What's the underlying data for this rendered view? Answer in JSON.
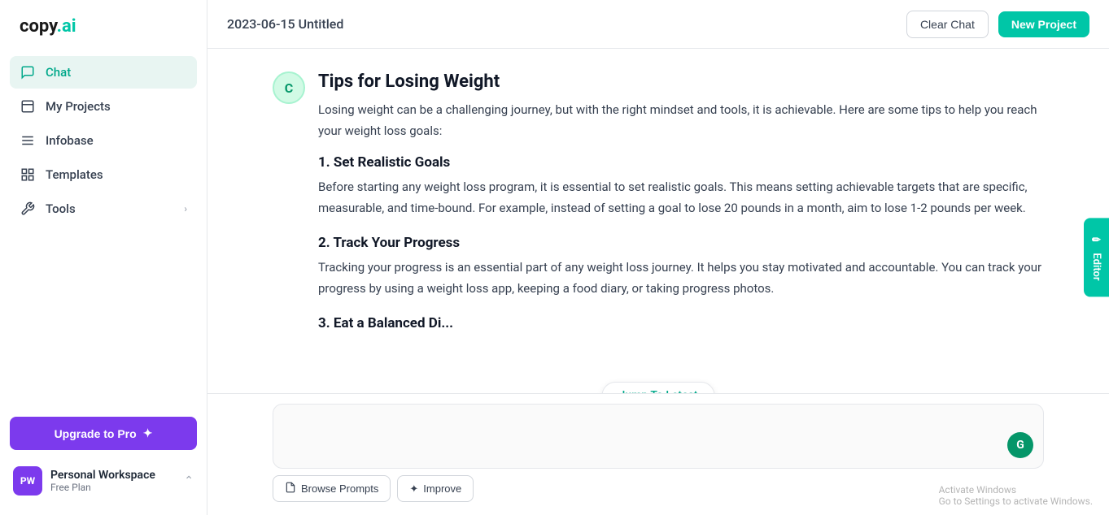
{
  "app": {
    "logo": "copy",
    "logo_dot": ".ai"
  },
  "header": {
    "title": "2023-06-15 Untitled",
    "clear_chat_label": "Clear Chat",
    "new_project_label": "New Project"
  },
  "sidebar": {
    "nav_items": [
      {
        "id": "chat",
        "label": "Chat",
        "icon": "💬",
        "active": true
      },
      {
        "id": "my-projects",
        "label": "My Projects",
        "icon": "📄",
        "active": false
      },
      {
        "id": "infobase",
        "label": "Infobase",
        "icon": "☰",
        "active": false
      },
      {
        "id": "templates",
        "label": "Templates",
        "icon": "⊞",
        "active": false
      },
      {
        "id": "tools",
        "label": "Tools",
        "icon": "🔧",
        "active": false,
        "has_chevron": true
      }
    ],
    "upgrade_btn": "Upgrade to Pro",
    "workspace": {
      "initials": "PW",
      "name": "Personal Workspace",
      "plan": "Free Plan"
    }
  },
  "chat": {
    "avatar_letter": "C",
    "message_title": "Tips for Losing Weight",
    "intro_text": "Losing weight can be a challenging journey, but with the right mindset and tools, it is achievable. Here are some tips to help you reach your weight loss goals:",
    "sections": [
      {
        "heading": "1. Set Realistic Goals",
        "text": "Before starting any weight loss program, it is essential to set realistic goals. This means setting achievable targets that are specific, measurable, and time-bound. For example, instead of setting a goal to lose 20 pounds in a month, aim to lose 1-2 pounds per week."
      },
      {
        "heading": "2. Track Your Progress",
        "text": "Tracking your progress is an essential part of any weight loss journey. It helps you stay motivated and accountable. You can track your progress by using a weight loss app, keeping a food diary, or taking progress photos."
      },
      {
        "heading": "3. Eat a Balanced Di...",
        "text": ""
      }
    ],
    "jump_to_latest": "Jump To Latest"
  },
  "input_area": {
    "browse_prompts_label": "Browse Prompts",
    "improve_label": "Improve",
    "g_letter": "G"
  },
  "editor_tab": {
    "label": "Editor",
    "icon": "✏️"
  },
  "watermark": {
    "line1": "Activate Windows",
    "line2": "Go to Settings to activate Windows."
  }
}
